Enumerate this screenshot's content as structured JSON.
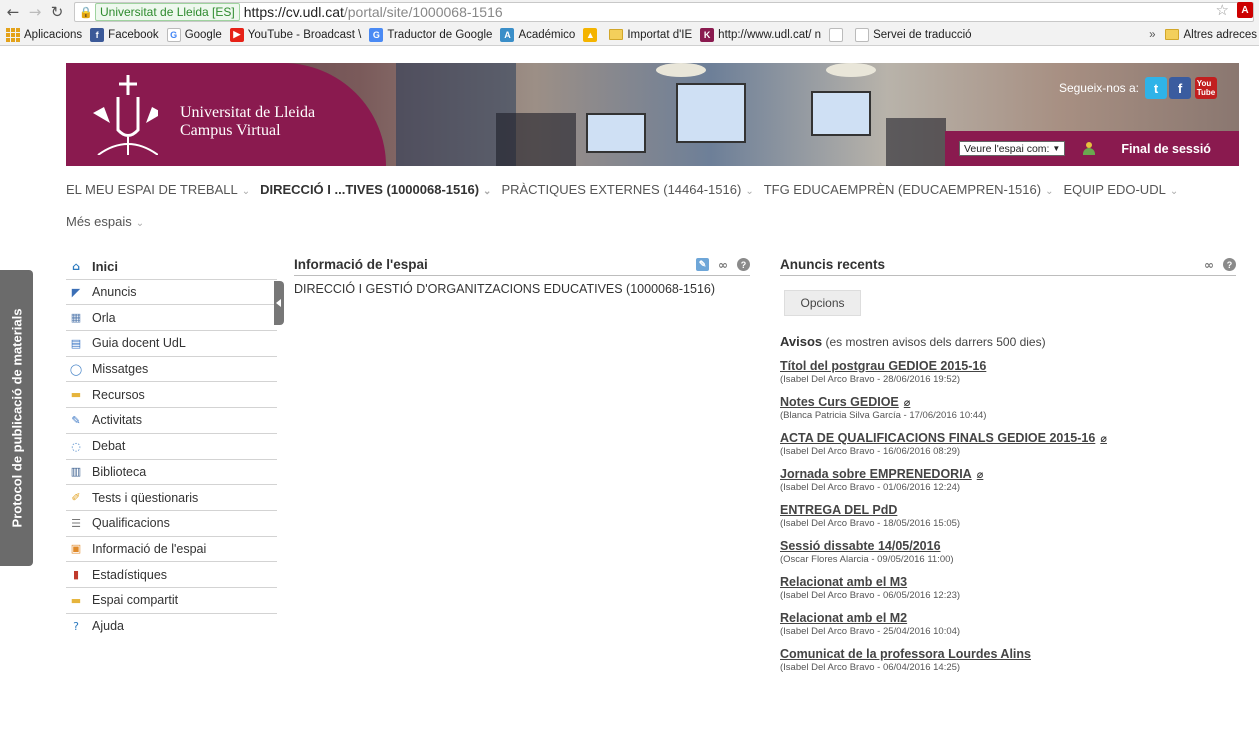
{
  "browser": {
    "secure_label": "Universitat de Lleida [ES]",
    "url_host": "https://cv.udl.cat",
    "url_path": "/portal/site/1000068-1516",
    "bookmarks": [
      {
        "label": "Aplicacions",
        "icon": "apps-icon"
      },
      {
        "label": "Facebook",
        "icon": "facebook-icon"
      },
      {
        "label": "Google",
        "icon": "google-icon"
      },
      {
        "label": "YouTube - Broadcast \\",
        "icon": "youtube-icon"
      },
      {
        "label": "Traductor de Google",
        "icon": "translate-icon"
      },
      {
        "label": "Académico",
        "icon": "academic-icon"
      },
      {
        "label": "",
        "icon": "drive-icon"
      },
      {
        "label": "Importat d'IE",
        "icon": "folder-icon"
      },
      {
        "label": "http://www.udl.cat/ n",
        "icon": "udl-icon"
      },
      {
        "label": "",
        "icon": "page-icon"
      },
      {
        "label": "Servei de traducció",
        "icon": "page-icon"
      }
    ],
    "more_label": "»",
    "other_bookmarks": "Altres adreces"
  },
  "side_tab": "Protocol de publicació de materials",
  "header": {
    "uni_line1": "Universitat de Lleida",
    "uni_line2": "Campus Virtual",
    "follow_label": "Segueix-nos a:",
    "role_select": "Veure l'espai com:",
    "logout": "Final de sessió"
  },
  "site_tabs": [
    {
      "label": "EL MEU ESPAI DE TREBALL",
      "current": false
    },
    {
      "label": "DIRECCIÓ I ...TIVES (1000068-1516)",
      "current": true
    },
    {
      "label": "PRÀCTIQUES EXTERNES (14464-1516)",
      "current": false
    },
    {
      "label": "TFG EDUCAEMPRÈN (EDUCAEMPREN-1516)",
      "current": false
    },
    {
      "label": "EQUIP EDO-UDL",
      "current": false
    },
    {
      "label": "Més espais",
      "current": false
    }
  ],
  "menu": [
    {
      "label": "Inici",
      "icon": "home-icon",
      "color": "#2e7bbf"
    },
    {
      "label": "Anuncis",
      "icon": "megaphone-icon",
      "color": "#3b6fb6"
    },
    {
      "label": "Orla",
      "icon": "grid-icon",
      "color": "#5a7fb0"
    },
    {
      "label": "Guia docent UdL",
      "icon": "document-icon",
      "color": "#3a76c4"
    },
    {
      "label": "Missatges",
      "icon": "message-icon",
      "color": "#4a86c8"
    },
    {
      "label": "Recursos",
      "icon": "folder-icon",
      "color": "#e6b43c"
    },
    {
      "label": "Activitats",
      "icon": "pencil-paper-icon",
      "color": "#3a76c4"
    },
    {
      "label": "Debat",
      "icon": "chat-icon",
      "color": "#4a86c8"
    },
    {
      "label": "Biblioteca",
      "icon": "book-icon",
      "color": "#3b5f8f"
    },
    {
      "label": "Tests i qüestionaris",
      "icon": "pencil-icon",
      "color": "#e0a020"
    },
    {
      "label": "Qualificacions",
      "icon": "list-icon",
      "color": "#777777"
    },
    {
      "label": "Informació de l'espai",
      "icon": "info-board-icon",
      "color": "#e08a2a"
    },
    {
      "label": "Estadístiques",
      "icon": "bar-chart-icon",
      "color": "#c0392b"
    },
    {
      "label": "Espai compartit",
      "icon": "shared-folder-icon",
      "color": "#e6b43c"
    },
    {
      "label": "Ajuda",
      "icon": "help-icon",
      "color": "#2e7bbf"
    }
  ],
  "info_portlet": {
    "title": "Informació de l'espai",
    "body": "DIRECCIÓ I GESTIÓ D'ORGANITZACIONS EDUCATIVES (1000068-1516)"
  },
  "announcements": {
    "title": "Anuncis recents",
    "options_label": "Opcions",
    "avisos_label": "Avisos",
    "avisos_note": "(es mostren avisos dels darrers 500 dies)",
    "items": [
      {
        "title": "Títol del postgrau GEDIOE 2015-16",
        "meta": "(Isabel Del Arco Bravo - 28/06/2016 19:52)",
        "attachment": false
      },
      {
        "title": "Notes Curs GEDIOE",
        "meta": "(Blanca Patricia Silva García - 17/06/2016 10:44)",
        "attachment": true
      },
      {
        "title": "ACTA DE QUALIFICACIONS FINALS GEDIOE 2015-16",
        "meta": "(Isabel Del Arco Bravo - 16/06/2016 08:29)",
        "attachment": true
      },
      {
        "title": "Jornada sobre EMPRENEDORIA",
        "meta": "(Isabel Del Arco Bravo - 01/06/2016 12:24)",
        "attachment": true
      },
      {
        "title": "ENTREGA DEL PdD",
        "meta": "(Isabel Del Arco Bravo - 18/05/2016 15:05)",
        "attachment": false
      },
      {
        "title": "Sessió dissabte 14/05/2016",
        "meta": "(Oscar Flores Alarcia - 09/05/2016 11:00)",
        "attachment": false
      },
      {
        "title": "Relacionat amb el M3",
        "meta": "(Isabel Del Arco Bravo - 06/05/2016 12:23)",
        "attachment": false
      },
      {
        "title": "Relacionat amb el M2",
        "meta": "(Isabel Del Arco Bravo - 25/04/2016 10:04)",
        "attachment": false
      },
      {
        "title": "Comunicat de la professora Lourdes Alins",
        "meta": "(Isabel Del Arco Bravo - 06/04/2016 14:25)",
        "attachment": false
      }
    ]
  }
}
